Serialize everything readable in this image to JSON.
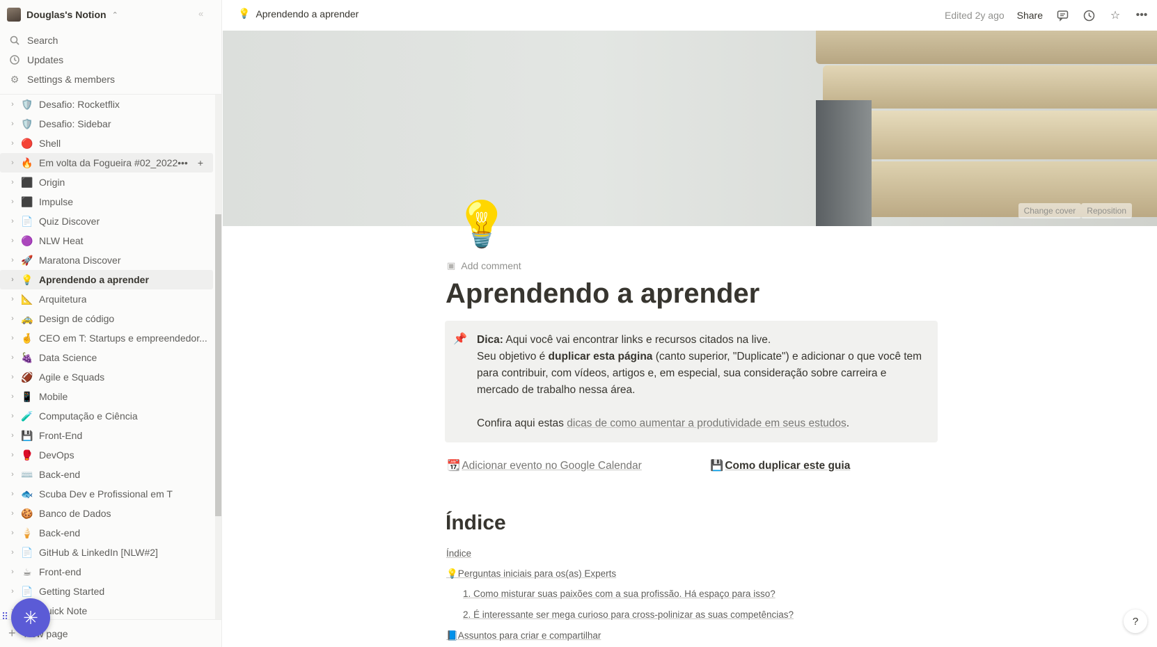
{
  "workspace": {
    "name": "Douglas's Notion"
  },
  "nav": [
    {
      "label": "Search",
      "icon": "search-icon"
    },
    {
      "label": "Updates",
      "icon": "clock-icon"
    },
    {
      "label": "Settings & members",
      "icon": "gear-icon"
    }
  ],
  "pages": [
    {
      "label": "Desafio: Rocketflix",
      "emoji": "🛡️"
    },
    {
      "label": "Desafio: Sidebar",
      "emoji": "🛡️"
    },
    {
      "label": "Shell",
      "emoji": "🔴"
    },
    {
      "label": "Em volta da Fogueira #02_2022",
      "emoji": "🔥"
    },
    {
      "label": "Origin",
      "emoji": "⬛"
    },
    {
      "label": "Impulse",
      "emoji": "⬛"
    },
    {
      "label": "Quiz Discover",
      "emoji": "📄"
    },
    {
      "label": "NLW Heat",
      "emoji": "🟣"
    },
    {
      "label": "Maratona Discover",
      "emoji": "🚀"
    },
    {
      "label": "Aprendendo a aprender",
      "emoji": "💡"
    },
    {
      "label": "Arquitetura",
      "emoji": "📐"
    },
    {
      "label": "Design de código",
      "emoji": "🚕"
    },
    {
      "label": "CEO em T: Startups e empreendedor...",
      "emoji": "🤞"
    },
    {
      "label": "Data Science",
      "emoji": "🍇"
    },
    {
      "label": "Agile e Squads",
      "emoji": "🏈"
    },
    {
      "label": "Mobile",
      "emoji": "📱"
    },
    {
      "label": "Computação e Ciência",
      "emoji": "🧪"
    },
    {
      "label": "Front-End",
      "emoji": "💾"
    },
    {
      "label": "DevOps",
      "emoji": "🥊"
    },
    {
      "label": "Back-end",
      "emoji": "⌨️"
    },
    {
      "label": "Scuba Dev e Profissional em T",
      "emoji": "🐟"
    },
    {
      "label": "Banco de Dados",
      "emoji": "🍪"
    },
    {
      "label": "Back-end",
      "emoji": "🍦"
    },
    {
      "label": "GitHub & LinkedIn [NLW#2]",
      "emoji": "📄"
    },
    {
      "label": "Front-end",
      "emoji": "☕"
    },
    {
      "label": "Getting Started",
      "emoji": "📄"
    },
    {
      "label": "Quick Note",
      "emoji": "📄"
    }
  ],
  "new_page": "New page",
  "topbar": {
    "breadcrumb_emoji": "💡",
    "breadcrumb": "Aprendendo a aprender",
    "edited": "Edited 2y ago",
    "share": "Share"
  },
  "cover": {
    "change": "Change cover",
    "reposition": "Reposition"
  },
  "page": {
    "icon": "💡",
    "add_comment": "Add comment",
    "title": "Aprendendo a aprender",
    "callout": {
      "icon": "📌",
      "bold1": "Dica:",
      "text1": " Aqui você vai encontrar links e recursos citados na live.",
      "text2a": "Seu objetivo é ",
      "bold2": "duplicar esta página",
      "text2b": " (canto superior, \"Duplicate\") e adicionar o que você tem para contribuir, com vídeos, artigos e, em especial, sua consideração sobre carreira e mercado de trabalho nessa área.",
      "text3a": "Confira aqui estas ",
      "link3": "dicas de como aumentar a produtividade em seus estudos",
      "text3b": "."
    },
    "link_calendar_emoji": "📆",
    "link_calendar": "Adicionar evento no Google Calendar",
    "link_duplicate_emoji": "💾",
    "link_duplicate": "Como duplicar este guia",
    "heading": "Índice",
    "toc": [
      "Índice",
      "💡Perguntas iniciais para os(as) Experts",
      "1. Como misturar suas paixões com a sua profissão. Há espaço para isso?",
      "2. É interessante ser mega curioso para cross-polinizar as suas competências?",
      "📘Assuntos para criar e compartilhar"
    ]
  },
  "help": "?"
}
